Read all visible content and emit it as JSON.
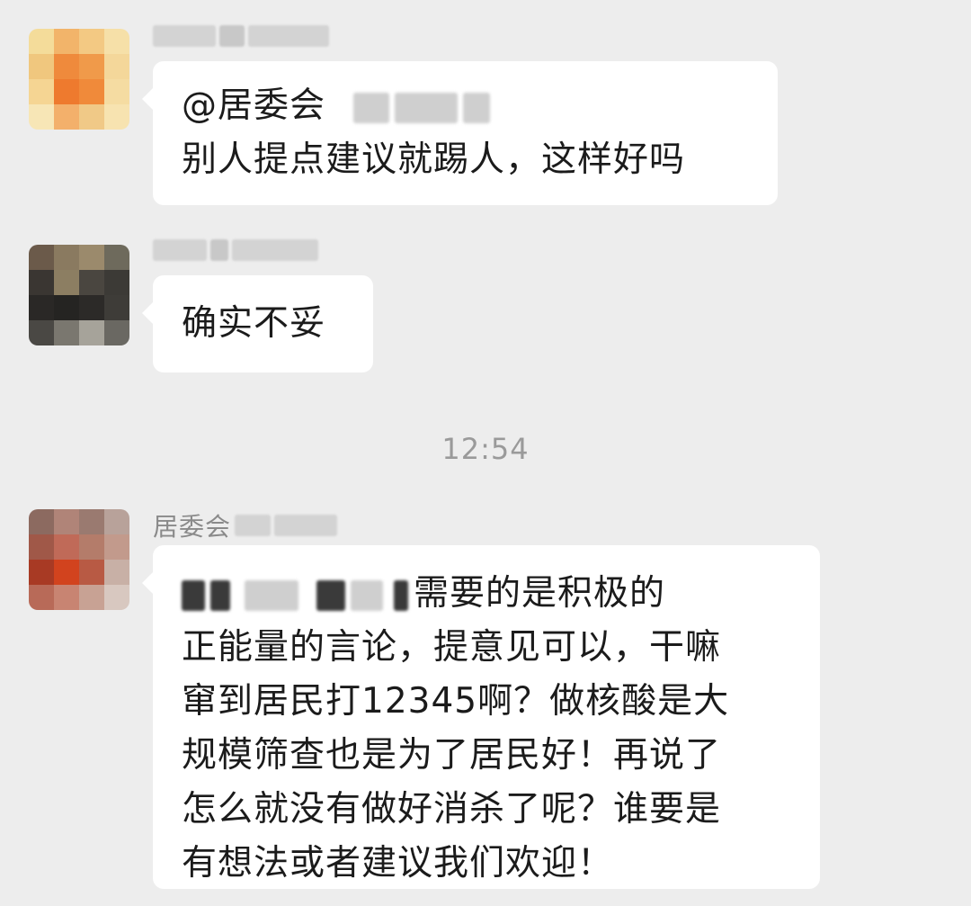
{
  "messages": [
    {
      "mention": "@居委会",
      "line2": "别人提点建议就踢人，这样好吗"
    },
    {
      "text": "确实不妥"
    },
    {
      "sender_name": "居委会",
      "line1_tail": "需要的是积极的",
      "lines": [
        "正能量的言论，提意见可以，干嘛",
        "窜到居民打12345啊？做核酸是大",
        "规模筛查也是为了居民好！再说了",
        "怎么就没有做好消杀了呢？谁要是",
        "有想法或者建议我们欢迎！"
      ]
    }
  ],
  "timestamp": "12:54"
}
